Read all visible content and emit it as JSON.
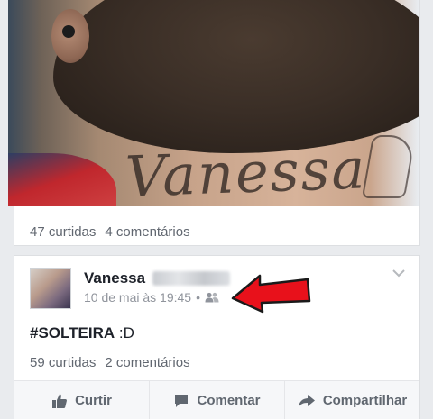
{
  "photo_post": {
    "tattoo_text": "Vanessa",
    "likes": "47 curtidas",
    "comments": "4 comentários"
  },
  "status_post": {
    "author": "Vanessa",
    "timestamp": "10 de mai às 19:45",
    "separator": "•",
    "privacy_icon": "friends-icon",
    "text_hashtag": "#SOLTEIRA",
    "text_rest": " :D",
    "likes": "59 curtidas",
    "comments": "2 comentários"
  },
  "actions": {
    "like": "Curtir",
    "comment": "Comentar",
    "share": "Compartilhar"
  },
  "colors": {
    "annotation_arrow": "#e8111b",
    "meta_text": "#90949c",
    "background": "#e9ebee"
  }
}
